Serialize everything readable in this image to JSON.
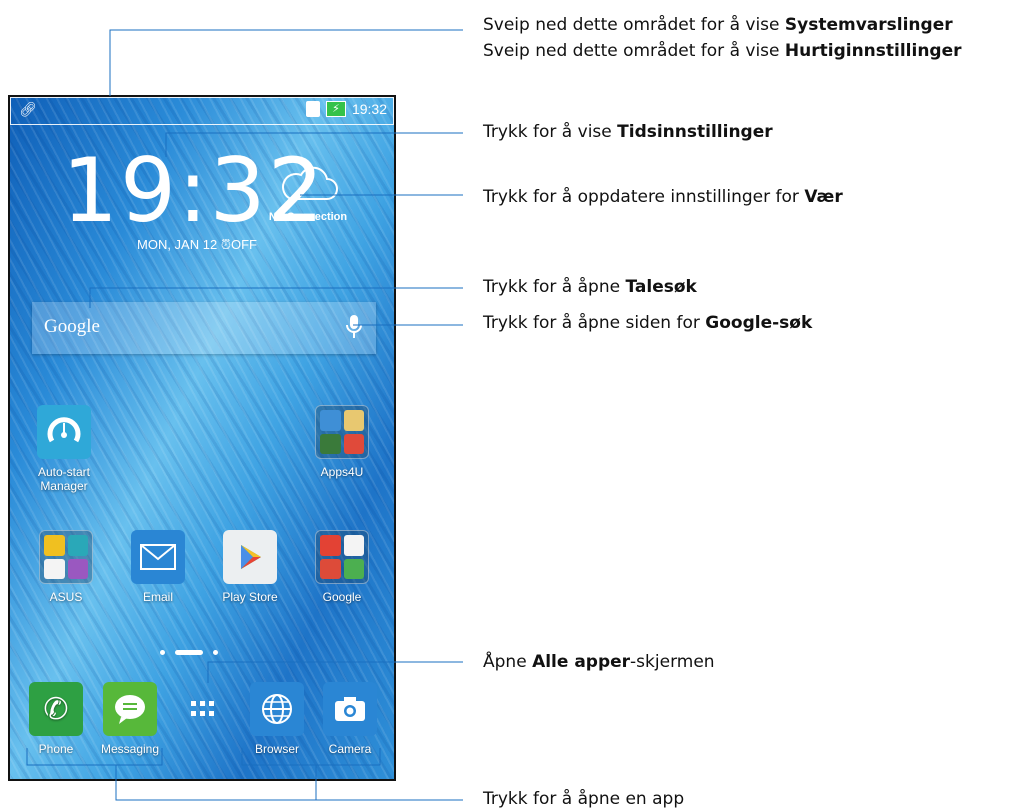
{
  "status": {
    "time": "19:32"
  },
  "clock": {
    "hours": "19",
    "minutes": "32",
    "date": "MON, JAN 12",
    "alarm": "OFF"
  },
  "weather": {
    "status": "No Connection"
  },
  "search": {
    "brand": "Google"
  },
  "apps": {
    "auto_start": {
      "label1": "Auto-start",
      "label2": "Manager"
    },
    "apps4u": {
      "label": "Apps4U"
    },
    "asus": {
      "label": "ASUS"
    },
    "email": {
      "label": "Email"
    },
    "play_store": {
      "label": "Play Store"
    },
    "google": {
      "label": "Google"
    }
  },
  "dock": {
    "phone": "Phone",
    "messaging": "Messaging",
    "browser": "Browser",
    "camera": "Camera"
  },
  "annotations": {
    "a1_pre": "Sveip ned dette området for å vise ",
    "a1_bold": "Systemvarslinger",
    "a2_pre": "Sveip ned dette området for å vise ",
    "a2_bold": "Hurtiginnstillinger",
    "a3_pre": "Trykk for å vise ",
    "a3_bold": "Tidsinnstillinger",
    "a4_pre": "Trykk for å oppdatere innstillinger for ",
    "a4_bold": "Vær",
    "a5_pre": "Trykk for å åpne ",
    "a5_bold": "Talesøk",
    "a6_pre": "Trykk for å åpne siden for ",
    "a6_bold": "Google-søk",
    "a7_pre": "Åpne ",
    "a7_bold": "Alle apper",
    "a7_post": "-skjermen",
    "a8": "Trykk for å åpne en app"
  }
}
